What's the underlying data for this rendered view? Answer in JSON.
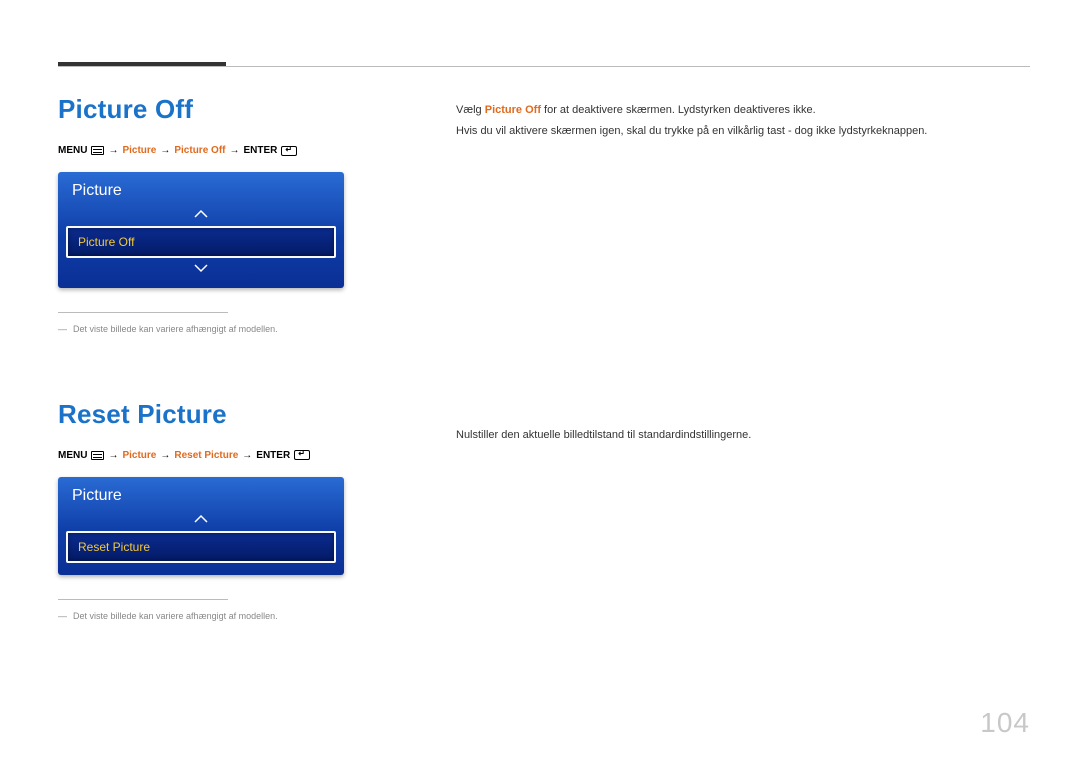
{
  "page_number": "104",
  "section1": {
    "title": "Picture Off",
    "breadcrumb": {
      "p1": "MENU",
      "p2": "Picture",
      "p3": "Picture Off",
      "p4": "ENTER"
    },
    "menu": {
      "header": "Picture",
      "selected": "Picture Off"
    },
    "note": "Det viste billede kan variere afhængigt af modellen.",
    "body": {
      "line1_pre": "Vælg ",
      "line1_bold": "Picture Off",
      "line1_post": " for at deaktivere skærmen. Lydstyrken deaktiveres ikke.",
      "line2": "Hvis du vil aktivere skærmen igen, skal du trykke på en vilkårlig tast - dog ikke lydstyrkeknappen."
    }
  },
  "section2": {
    "title": "Reset Picture",
    "breadcrumb": {
      "p1": "MENU",
      "p2": "Picture",
      "p3": "Reset Picture",
      "p4": "ENTER"
    },
    "menu": {
      "header": "Picture",
      "selected": "Reset Picture"
    },
    "note": "Det viste billede kan variere afhængigt af modellen.",
    "body": {
      "line1": "Nulstiller den aktuelle billedtilstand til standardindstillingerne."
    }
  }
}
